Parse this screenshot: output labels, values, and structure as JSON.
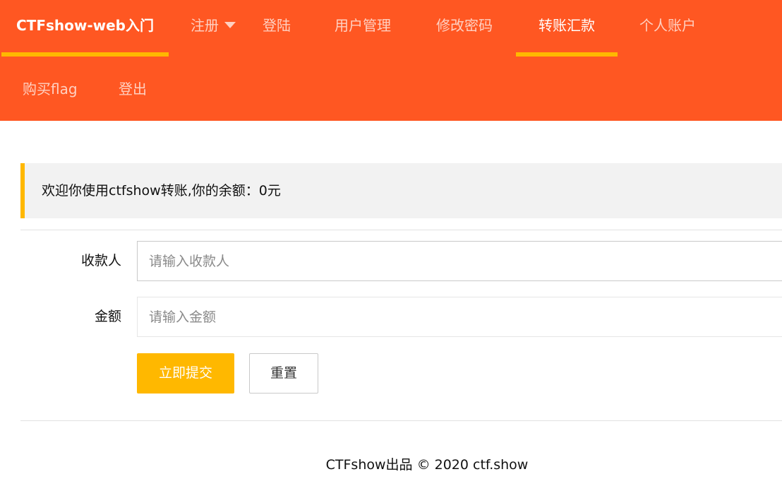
{
  "nav": {
    "brand": "CTFshow-web入门",
    "items": [
      {
        "label": "注册",
        "has_dropdown": true
      },
      {
        "label": "登陆"
      },
      {
        "label": "用户管理"
      },
      {
        "label": "修改密码"
      },
      {
        "label": "转账汇款",
        "active": true
      },
      {
        "label": "个人账户"
      },
      {
        "label": "购买flag"
      },
      {
        "label": "登出"
      }
    ]
  },
  "notice": {
    "text": "欢迎你使用ctfshow转账,你的余额：0元"
  },
  "form": {
    "payee": {
      "label": "收款人",
      "value": "",
      "placeholder": "请输入收款人"
    },
    "amount": {
      "label": "金额",
      "value": "",
      "placeholder": "请输入金额"
    },
    "submit_label": "立即提交",
    "reset_label": "重置"
  },
  "footer": {
    "text": "CTFshow出品 © 2020 ctf.show"
  },
  "colors": {
    "nav_bg": "#ff5722",
    "accent": "#ffb800",
    "notice_bg": "#f2f2f2"
  }
}
